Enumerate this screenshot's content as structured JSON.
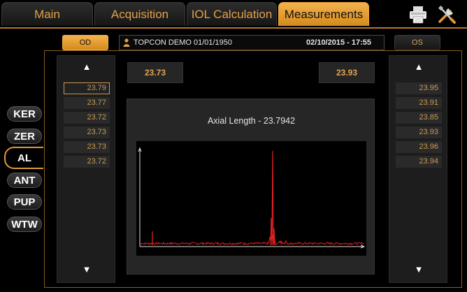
{
  "tabs": [
    {
      "label": "Main",
      "active": false
    },
    {
      "label": "Acquisition",
      "active": false
    },
    {
      "label": "IOL Calculation",
      "active": false
    },
    {
      "label": "Measurements",
      "active": true
    }
  ],
  "toolbar": {
    "print_icon": "printer-icon",
    "settings_icon": "tools-icon"
  },
  "eyes": {
    "od_label": "OD",
    "os_label": "OS"
  },
  "patient": {
    "name": "TOPCON DEMO 01/01/1950",
    "datetime": "02/10/2015 - 17:55"
  },
  "left_eye": {
    "average": "23.73",
    "values": [
      "23.79",
      "23.77",
      "23.72",
      "23.73",
      "23.73",
      "23.72"
    ],
    "selected_index": 0
  },
  "right_eye": {
    "average": "23.93",
    "values": [
      "23.95",
      "23.91",
      "23.85",
      "23.93",
      "23.96",
      "23.94"
    ]
  },
  "arrows": {
    "up": "▲",
    "down": "▼"
  },
  "modes": [
    {
      "label": "KER",
      "active": false
    },
    {
      "label": "ZER",
      "active": false
    },
    {
      "label": "AL",
      "active": true
    },
    {
      "label": "ANT",
      "active": false
    },
    {
      "label": "PUP",
      "active": false
    },
    {
      "label": "WTW",
      "active": false
    }
  ],
  "graph": {
    "title": "Axial Length - 23.7942",
    "trace_color": "#e02020"
  }
}
